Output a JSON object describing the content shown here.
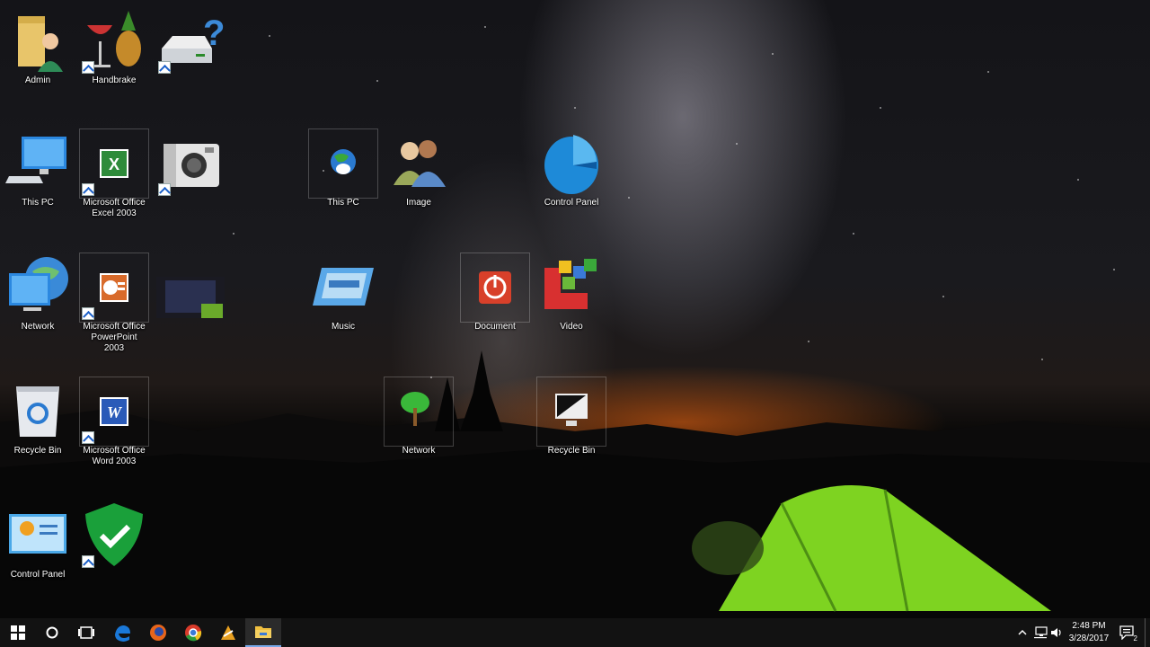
{
  "desktop": {
    "icons": {
      "admin": {
        "label": "Admin"
      },
      "handbrake": {
        "label": "Handbrake"
      },
      "drive_unknown": {
        "label": ""
      },
      "this_pc_1": {
        "label": "This PC"
      },
      "excel": {
        "label": "Microsoft Office Excel 2003"
      },
      "camera": {
        "label": ""
      },
      "this_pc_2": {
        "label": "This PC"
      },
      "image": {
        "label": "Image"
      },
      "control_panel_pie": {
        "label": "Control Panel"
      },
      "network_1": {
        "label": "Network"
      },
      "powerpoint": {
        "label": "Microsoft Office PowerPoint 2003"
      },
      "movie": {
        "label": ""
      },
      "music": {
        "label": "Music"
      },
      "document": {
        "label": "Document"
      },
      "video": {
        "label": "Video"
      },
      "recycle_bin_1": {
        "label": "Recycle Bin"
      },
      "word": {
        "label": "Microsoft Office Word 2003"
      },
      "network_2": {
        "label": "Network"
      },
      "recycle_bin_2": {
        "label": "Recycle Bin"
      },
      "control_panel_2": {
        "label": "Control Panel"
      },
      "security_shield": {
        "label": ""
      }
    }
  },
  "taskbar": {
    "buttons": [
      "windows-icon",
      "cortana-icon",
      "task-view-icon",
      "edge-icon",
      "firefox-icon",
      "chrome-icon",
      "winamp-icon",
      "file-explorer-icon"
    ],
    "tray": {
      "time": "2:48 PM",
      "date": "3/28/2017",
      "notification_count": "2"
    }
  },
  "colors": {
    "taskbar_bg": "#121212",
    "accent": "#78a8e8",
    "tent": "#7ed321"
  }
}
